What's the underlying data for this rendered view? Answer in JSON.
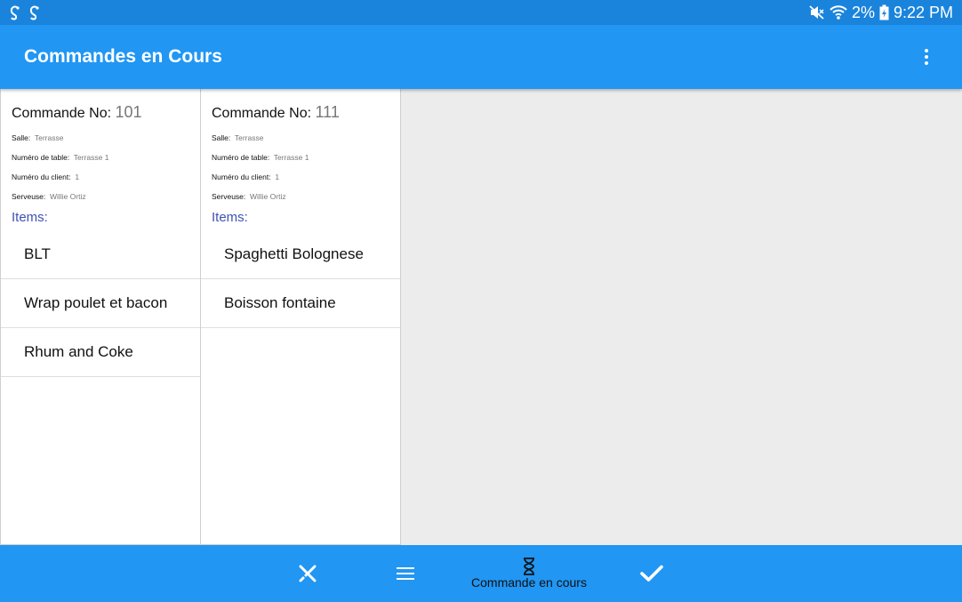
{
  "status_bar": {
    "left_icons": [
      "notification-icon",
      "notification-icon"
    ],
    "mute_icon": "mute-icon",
    "wifi_icon": "wifi-icon",
    "battery_percent": "2%",
    "battery_icon": "battery-charging-icon",
    "time": "9:22 PM"
  },
  "app_bar": {
    "title": "Commandes en Cours",
    "menu_icon": "overflow-menu-icon"
  },
  "orders": [
    {
      "title_label": "Commande No:",
      "number": "101",
      "salle_label": "Salle:",
      "salle": "Terrasse",
      "table_label": "Numéro de table:",
      "table": "Terrasse 1",
      "client_label": "Numéro du client:",
      "client": "1",
      "serveuse_label": "Serveuse:",
      "serveuse": "Willie Ortiz",
      "items_label": "Items:",
      "items": [
        "BLT",
        "Wrap poulet et bacon",
        "Rhum and Coke"
      ]
    },
    {
      "title_label": "Commande No:",
      "number": "111",
      "salle_label": "Salle:",
      "salle": "Terrasse",
      "table_label": "Numéro de table:",
      "table": "Terrasse 1",
      "client_label": "Numéro du client:",
      "client": "1",
      "serveuse_label": "Serveuse:",
      "serveuse": "Willie Ortiz",
      "items_label": "Items:",
      "items": [
        "Spaghetti Bolognese",
        "Boisson fontaine"
      ]
    }
  ],
  "bottom_nav": {
    "items": [
      {
        "icon": "utensils-icon",
        "label": ""
      },
      {
        "icon": "menu-lines-icon",
        "label": ""
      },
      {
        "icon": "hourglass-icon",
        "label": "Commande en cours",
        "active": true
      },
      {
        "icon": "checkmark-icon",
        "label": ""
      }
    ]
  },
  "colors": {
    "status_bar": "#1a84dc",
    "primary": "#2196f3",
    "items_label": "#3f51b5",
    "background": "#ececec",
    "card": "#ffffff"
  }
}
